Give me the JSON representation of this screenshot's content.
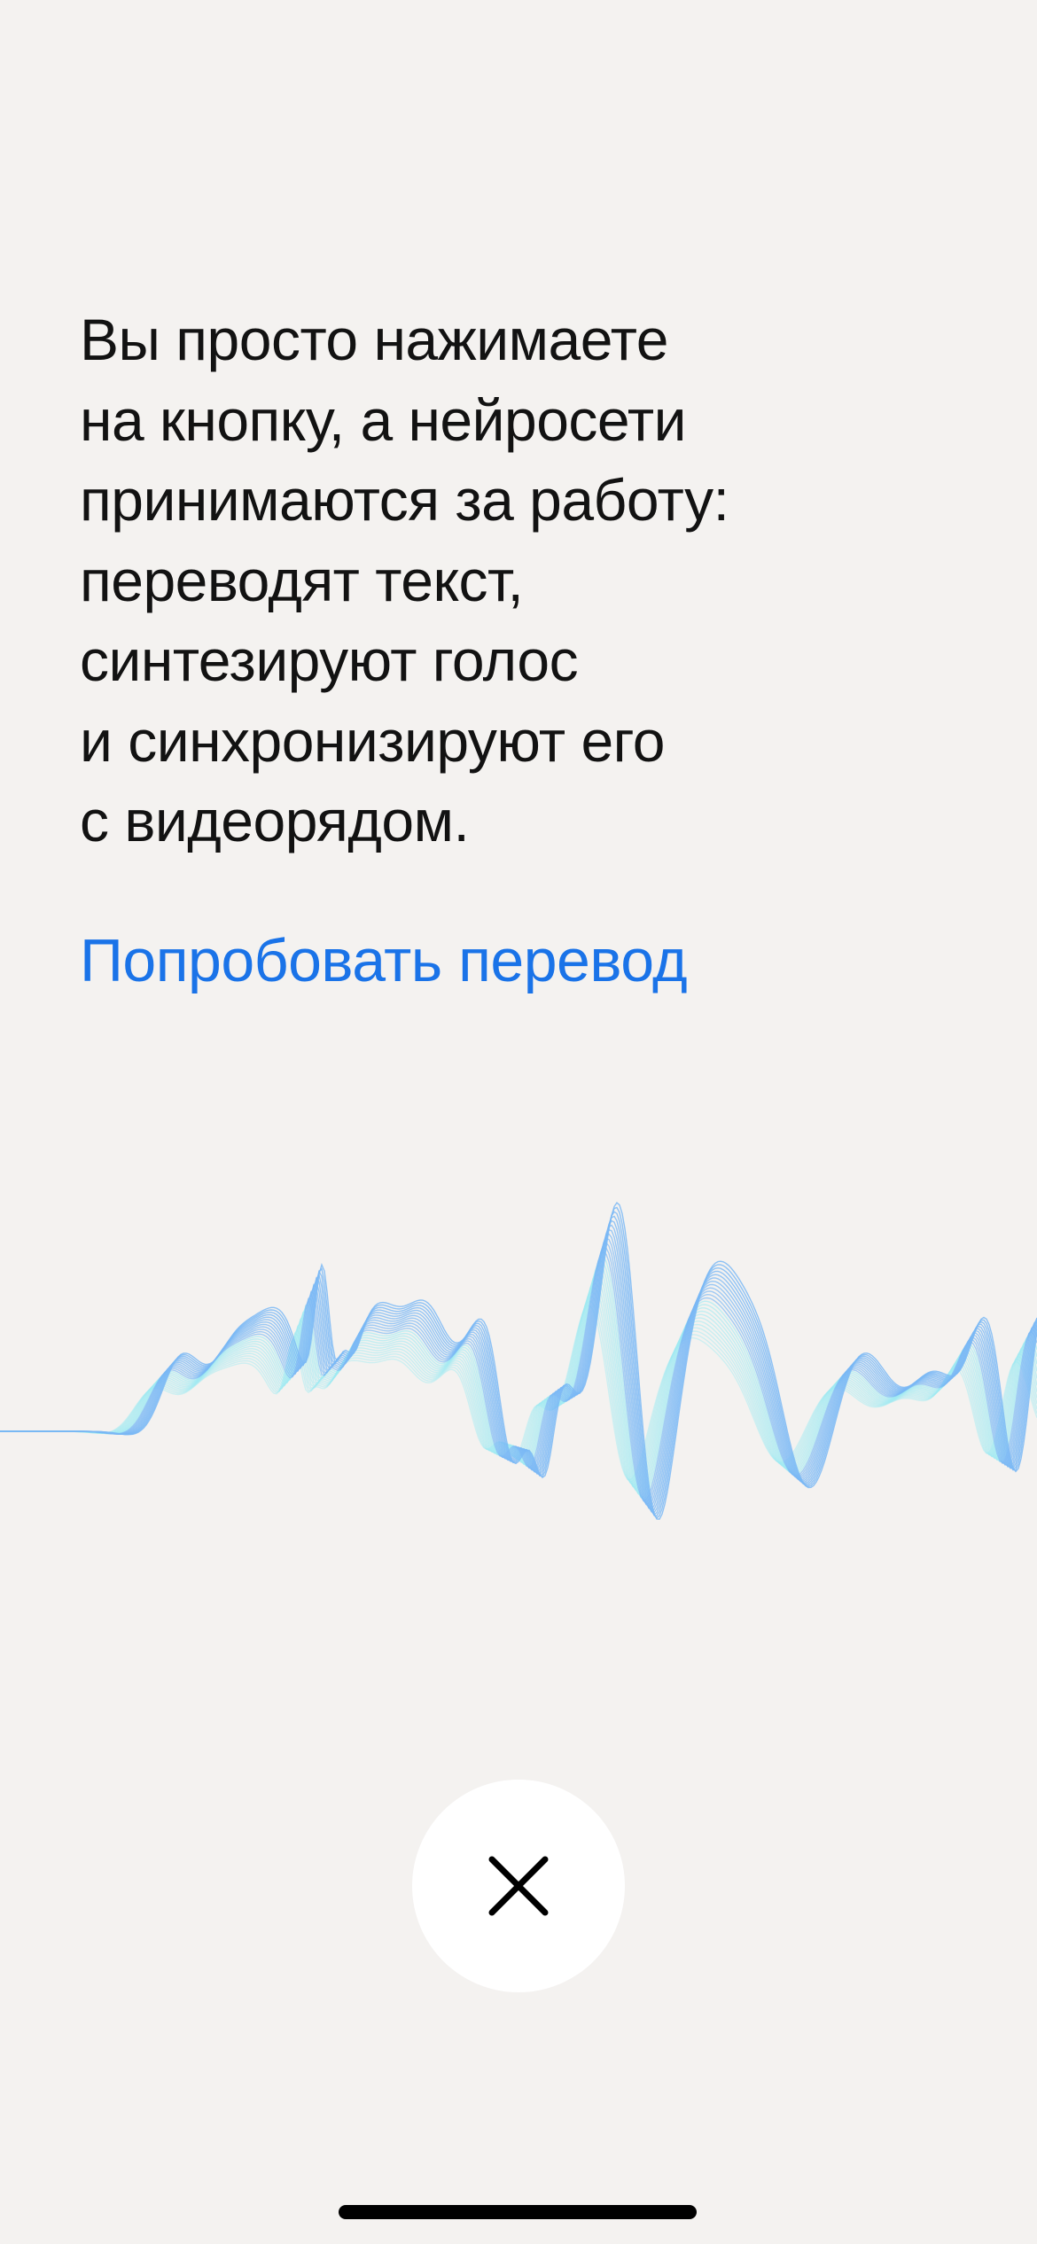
{
  "content": {
    "description_lines": [
      "Вы просто нажимаете",
      "на кнопку, а нейросети",
      "принимаются за работу:",
      "переводят текст,",
      "синтезируют голос",
      "и синхронизируют его",
      "с видеорядом."
    ],
    "try_link_label": "Попробовать перевод"
  },
  "icons": {
    "close": "close-icon",
    "waveform": "sound-wave-illustration"
  },
  "colors": {
    "background": "#f4f2f0",
    "text": "#121212",
    "link": "#1a73e8",
    "wave_light": "#9eeaf2",
    "wave_blue": "#7ab8f5",
    "close_button_bg": "#ffffff"
  }
}
